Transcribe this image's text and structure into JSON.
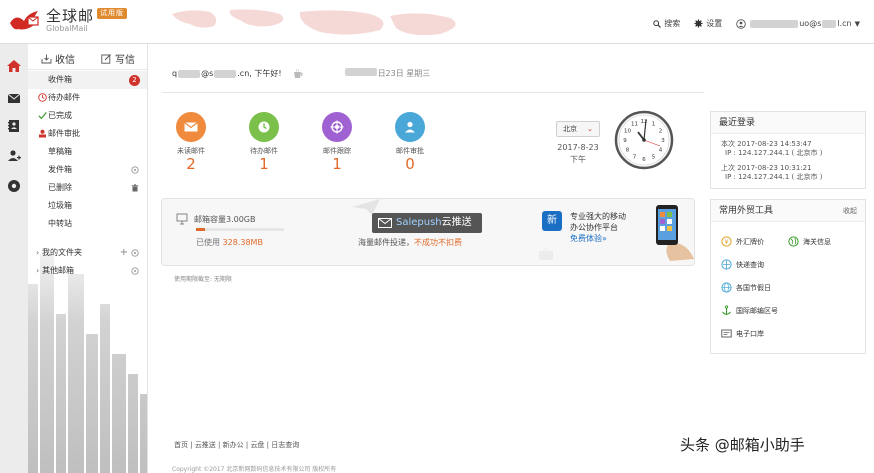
{
  "brand": {
    "name_cn": "全球邮",
    "name_en": "GlobalMail",
    "trial_badge": "试用版"
  },
  "header": {
    "search_label": "搜索",
    "settings_label": "设置",
    "user_email_prefix": "uo@s",
    "user_email_suffix": "l.cn"
  },
  "sidebar": {
    "receive_label": "收信",
    "compose_label": "写信",
    "items": [
      {
        "label": "收件箱",
        "badge": "2"
      },
      {
        "label": "待办邮件"
      },
      {
        "label": "已完成"
      },
      {
        "label": "邮件审批"
      },
      {
        "label": "草稿箱"
      },
      {
        "label": "发件箱"
      },
      {
        "label": "已删除"
      },
      {
        "label": "垃圾箱"
      },
      {
        "label": "中转站"
      }
    ],
    "folders": [
      {
        "label": "我的文件夹"
      },
      {
        "label": "其他邮箱"
      }
    ]
  },
  "greeting": {
    "email_start": "q",
    "email_mid": "@s",
    "email_end": ".cn, 下午好!",
    "date_suffix": "日23日 星期三"
  },
  "stats": [
    {
      "label": "未读邮件",
      "value": "2",
      "color": "#f08a3c"
    },
    {
      "label": "待办邮件",
      "value": "1",
      "color": "#7ac04a"
    },
    {
      "label": "邮件跟踪",
      "value": "1",
      "color": "#a062d2"
    },
    {
      "label": "邮件审批",
      "value": "0",
      "color": "#4aa8d8"
    }
  ],
  "weather": {
    "city": "北京",
    "date": "2017-8-23",
    "period": "下午"
  },
  "clock": {
    "hour_numbers": [
      "12",
      "1",
      "2",
      "3",
      "4",
      "5",
      "6",
      "7",
      "8",
      "9",
      "10",
      "11"
    ]
  },
  "promo": {
    "capacity_label": "邮箱容量3.00GB",
    "used_label": "已使用",
    "used_value": "328.38MB",
    "used_fraction": 0.107,
    "salepush_brand": "Salepush",
    "salepush_suffix": "云推送",
    "salepush_sub": "海量邮件投递，",
    "salepush_sub_highlight": "不成功不扣费",
    "mobile_icon": "新",
    "mobile_line1": "专业强大的移动",
    "mobile_line2": "办公协作平台",
    "mobile_link": "免费体验»"
  },
  "expire_text": "使用期限截至: 无期限",
  "footer": {
    "links": [
      "首页",
      "云推送",
      "新办公",
      "云盘",
      "日志查询"
    ],
    "copyright": "Copyright ©2017 北京新网数码信息技术有限公司 版权所有"
  },
  "right_panel": {
    "login_title": "最近登录",
    "login_current": "本次 2017-08-23 14:53:47",
    "login_current_ip": "IP : 124.127.244.1 ( 北京市 )",
    "login_prev": "上次 2017-08-23 10:31:21",
    "login_prev_ip": "IP : 124.127.244.1 ( 北京市 )",
    "tools_title": "常用外贸工具",
    "tools_collapse": "收起",
    "tools": [
      "外汇牌价",
      "海关信息",
      "快递查询",
      "各国节假日",
      "国际邮编区号",
      "电子口岸"
    ]
  },
  "watermark": "头条 @邮箱小助手",
  "colors": {
    "accent": "#e06a2a",
    "badge": "#d0322c",
    "link": "#1a6ec4"
  }
}
